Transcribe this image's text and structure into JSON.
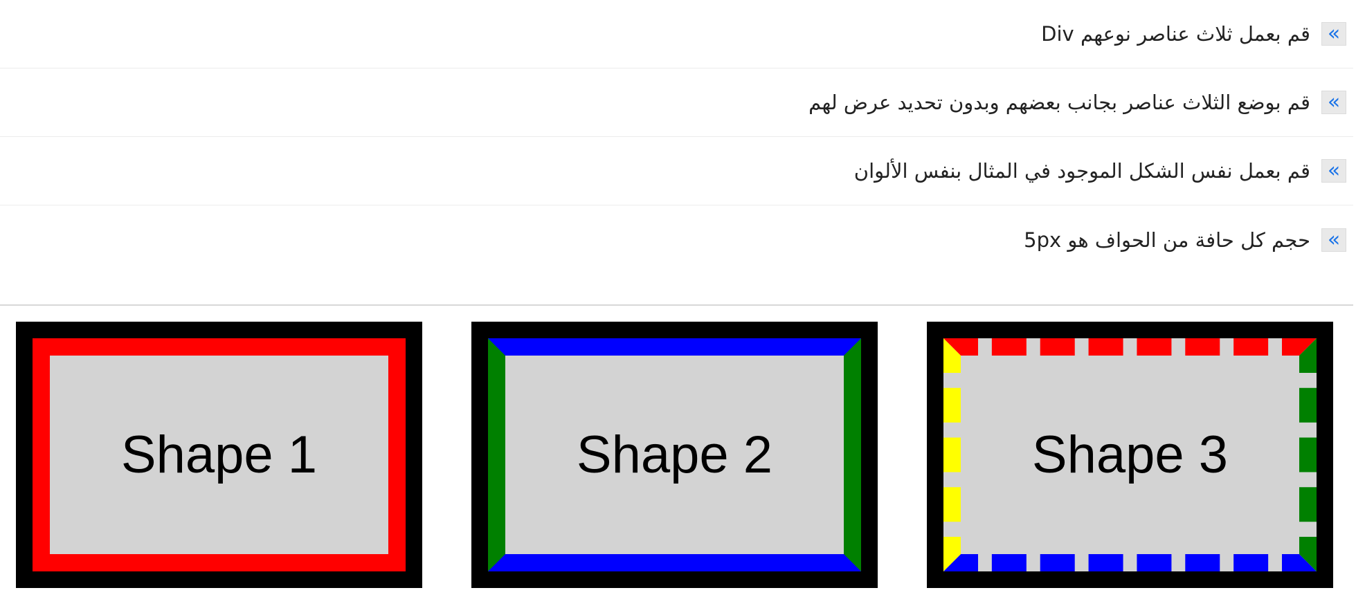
{
  "instructions": [
    {
      "bullet": "«",
      "text": "قم بعمل ثلاث عناصر نوعهم Div"
    },
    {
      "bullet": "«",
      "text": "قم بوضع الثلاث عناصر بجانب بعضهم وبدون تحديد عرض لهم"
    },
    {
      "bullet": "«",
      "text": "قم بعمل نفس الشكل الموجود في المثال بنفس الألوان"
    },
    {
      "bullet": "«",
      "text": "حجم كل حافة من الحواف هو 5px"
    }
  ],
  "shapes": [
    {
      "label": "Shape 1",
      "outer_color": "#000000",
      "fill_color": "#d3d3d3",
      "border_style": "solid",
      "border_colors": {
        "top": "#ff0000",
        "right": "#ff0000",
        "bottom": "#ff0000",
        "left": "#ff0000"
      }
    },
    {
      "label": "Shape 2",
      "outer_color": "#000000",
      "fill_color": "#d3d3d3",
      "border_style": "solid",
      "border_colors": {
        "top": "#0000ff",
        "right": "#008000",
        "bottom": "#0000ff",
        "left": "#008000"
      }
    },
    {
      "label": "Shape 3",
      "outer_color": "#000000",
      "fill_color": "#d3d3d3",
      "border_style": "dashed",
      "border_colors": {
        "top": "#ff0000",
        "right": "#008000",
        "bottom": "#0000ff",
        "left": "#ffff00"
      }
    }
  ],
  "colors": {
    "bullet_icon": "#1a73e8",
    "bullet_background": "#e9e9e9",
    "text": "#222222",
    "row_separator": "#ececec"
  }
}
